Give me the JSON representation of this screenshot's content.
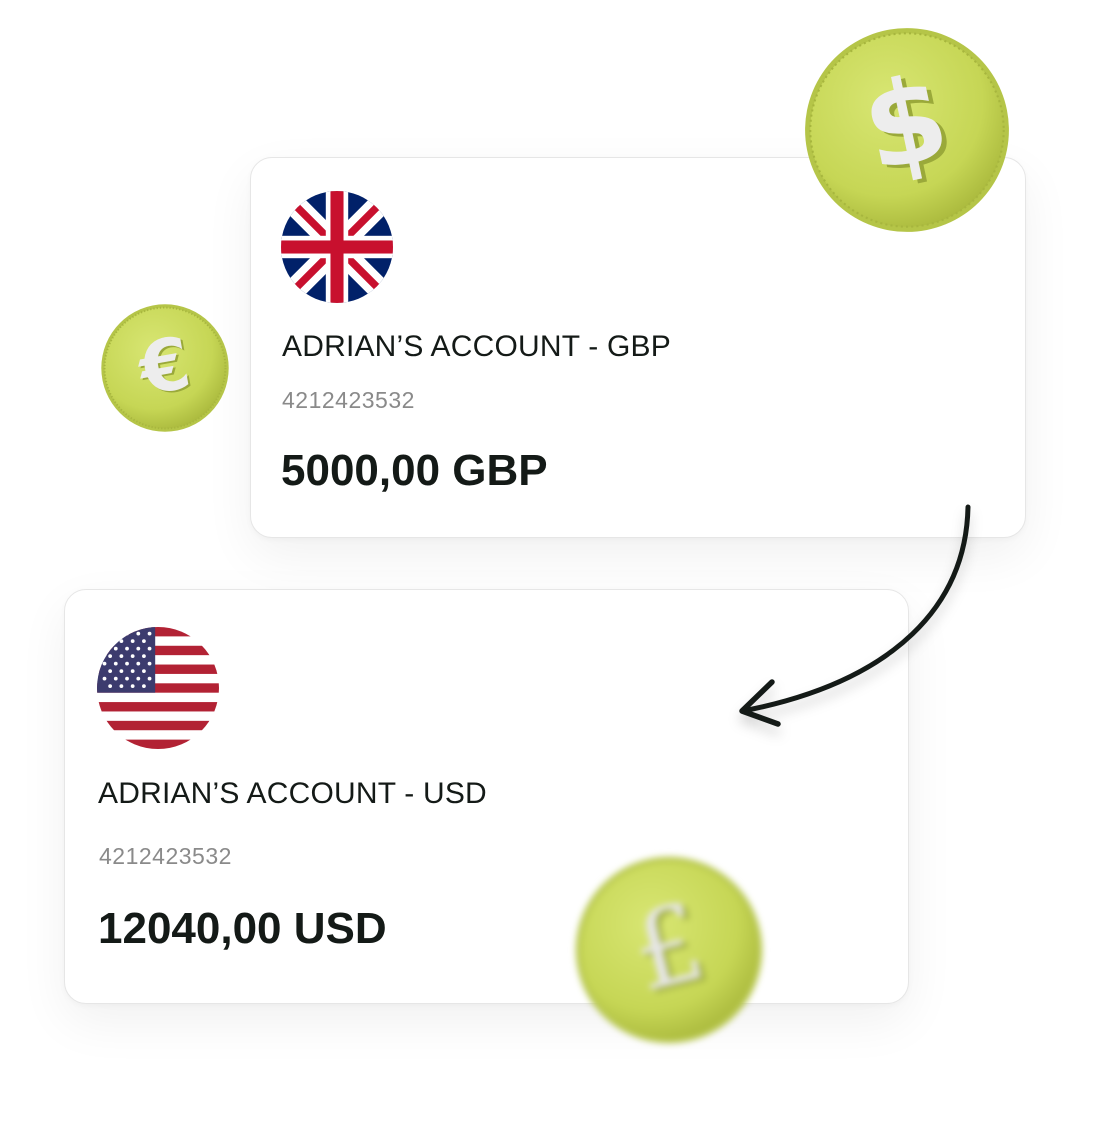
{
  "accounts": [
    {
      "name": "ADRIAN’S ACCOUNT - GBP",
      "number": "4212423532",
      "balance": "5000,00 GBP",
      "flag_icon": "uk-flag-icon"
    },
    {
      "name": "ADRIAN’S ACCOUNT - USD",
      "number": "4212423532",
      "balance": "12040,00 USD",
      "flag_icon": "us-flag-icon"
    }
  ],
  "decorations": {
    "coins": [
      "dollar-coin-icon",
      "euro-coin-icon",
      "pound-coin-icon"
    ],
    "transfer_arrow": "curved-arrow-icon"
  },
  "colors": {
    "coin": "#c9d95a",
    "coin_symbol": "#ececec",
    "text_primary": "#141a17",
    "text_secondary": "#8a8a8a",
    "card_border": "#e6e6e6"
  }
}
